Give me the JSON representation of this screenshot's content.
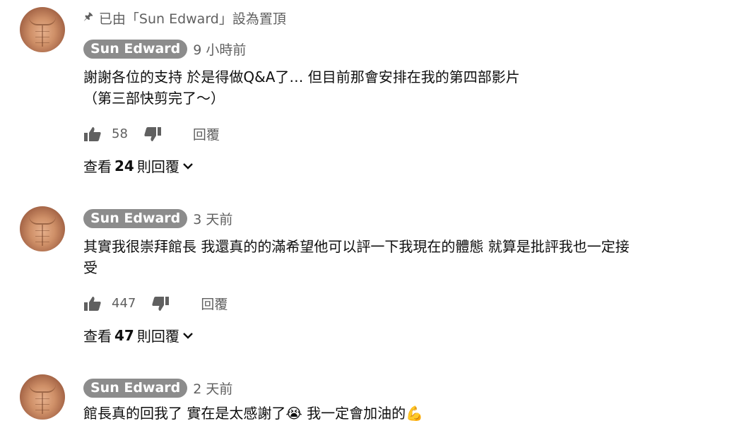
{
  "comments": [
    {
      "pinned_text": "已由「Sun Edward」設為置頂",
      "author": "Sun Edward",
      "time": "9 小時前",
      "lines": [
        "謝謝各位的支持 於是得做Q&A了… 但目前那會安排在我的第四部影片",
        "（第三部快剪完了～）"
      ],
      "likes": "58",
      "reply_label": "回覆",
      "view_prefix": "查看",
      "reply_count": "24",
      "view_suffix": "則回覆"
    },
    {
      "author": "Sun Edward",
      "time": "3 天前",
      "lines": [
        "其實我很崇拜館長 我還真的的滿希望他可以評一下我現在的體態 就算是批評我也一定接",
        "受"
      ],
      "likes": "447",
      "reply_label": "回覆",
      "view_prefix": "查看",
      "reply_count": "47",
      "view_suffix": "則回覆"
    },
    {
      "author": "Sun Edward",
      "time": "2 天前",
      "lines": [
        "館長真的回我了 實在是太感謝了😭 我一定會加油的💪"
      ]
    }
  ],
  "icons": {
    "pin": "pin-icon",
    "like": "thumbs-up-icon",
    "dislike": "thumbs-down-icon",
    "expand": "chevron-down-icon"
  }
}
